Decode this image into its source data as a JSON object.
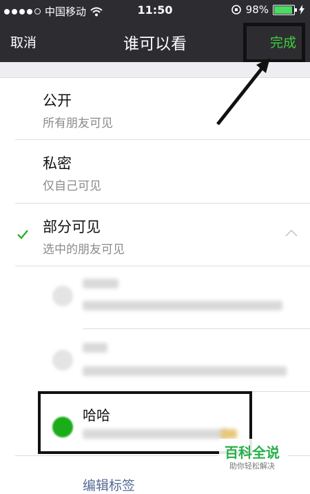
{
  "status_bar": {
    "carrier": "中国移动",
    "time": "11:50",
    "battery": "98%",
    "battery_level": 0.98
  },
  "navbar": {
    "cancel_label": "取消",
    "title": "谁可以看",
    "done_label": "完成"
  },
  "options": [
    {
      "title": "公开",
      "subtitle": "所有朋友可见",
      "selected": false
    },
    {
      "title": "私密",
      "subtitle": "仅自己可见",
      "selected": false
    },
    {
      "title": "部分可见",
      "subtitle": "选中的朋友可见",
      "selected": true,
      "expanded": true
    }
  ],
  "friends": [
    {
      "name": "哈哈",
      "selected": true
    }
  ],
  "edit_tags_label": "编辑标签",
  "watermark": {
    "title": "百科全说",
    "subtitle": "助你轻松解决"
  },
  "colors": {
    "accent": "#1aad19",
    "navbar": "#2d2d31",
    "link": "#576b95"
  }
}
